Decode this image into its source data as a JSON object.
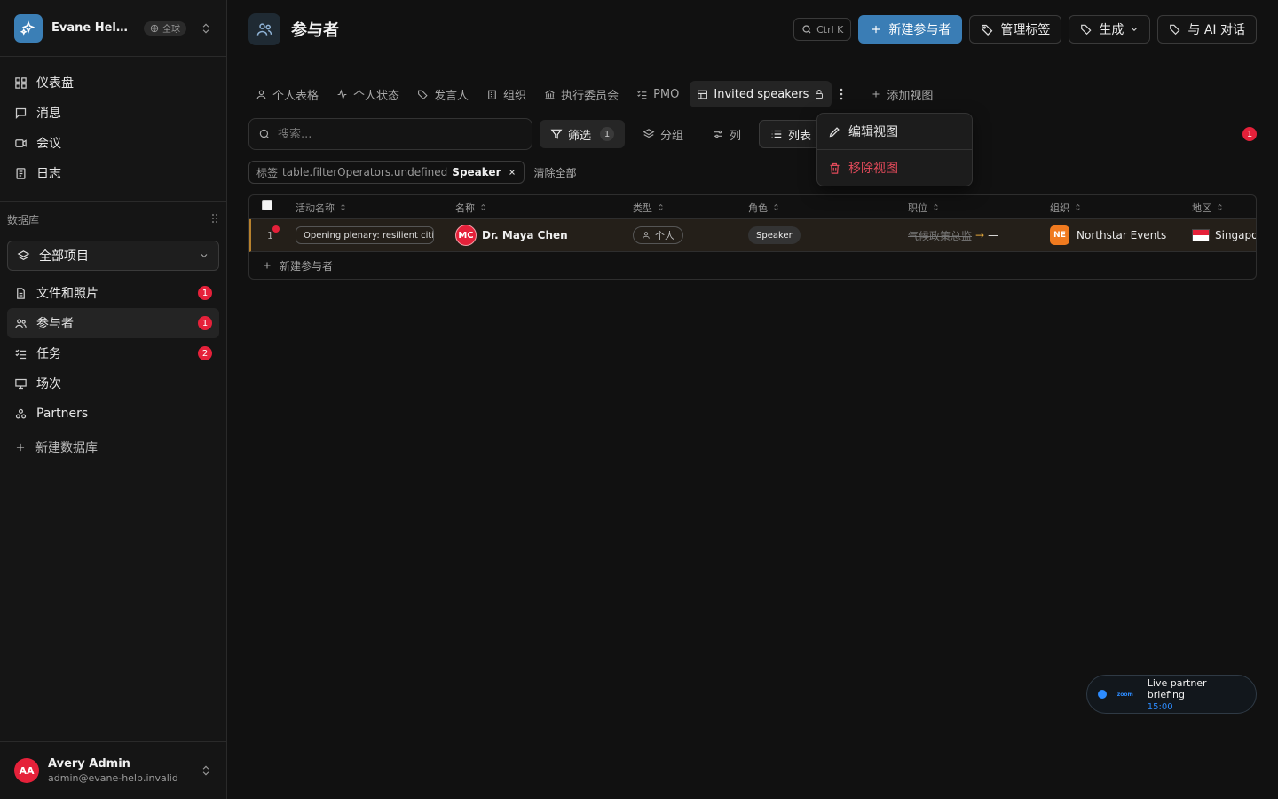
{
  "workspace": {
    "name": "Evane Help Center",
    "scope": "全球"
  },
  "nav": [
    {
      "label": "仪表盘",
      "icon": "dashboard-icon"
    },
    {
      "label": "消息",
      "icon": "message-icon"
    },
    {
      "label": "会议",
      "icon": "video-icon"
    },
    {
      "label": "日志",
      "icon": "log-icon"
    }
  ],
  "database": {
    "section_label": "数据库",
    "selector_label": "全部项目",
    "items": [
      {
        "label": "文件和照片",
        "badge": "1",
        "icon": "file-icon"
      },
      {
        "label": "参与者",
        "badge": "1",
        "icon": "users-icon",
        "active": true
      },
      {
        "label": "任务",
        "badge": "2",
        "icon": "tasks-icon"
      },
      {
        "label": "场次",
        "badge": "",
        "icon": "presentation-icon"
      },
      {
        "label": "Partners",
        "badge": "",
        "icon": "partners-icon"
      }
    ],
    "new_label": "新建数据库"
  },
  "user": {
    "initials": "AA",
    "name": "Avery Admin",
    "email": "admin@evane-help.invalid"
  },
  "header": {
    "title": "参与者",
    "shortcut": "Ctrl K",
    "new_button": "新建参与者",
    "manage_tags": "管理标签",
    "generate": "生成",
    "ai_chat": "与 AI 对话"
  },
  "tabs": [
    {
      "label": "个人表格",
      "icon": "person-icon"
    },
    {
      "label": "个人状态",
      "icon": "activity-icon"
    },
    {
      "label": "发言人",
      "icon": "tag-icon"
    },
    {
      "label": "组织",
      "icon": "building-icon"
    },
    {
      "label": "执行委员会",
      "icon": "bank-icon"
    },
    {
      "label": "PMO",
      "icon": "checklist-icon"
    },
    {
      "label": "Invited speakers",
      "icon": "table-icon",
      "active": true
    },
    {
      "label": "添加视图",
      "icon": "plus-icon"
    }
  ],
  "toolbar": {
    "search_placeholder": "搜索...",
    "filter_label": "筛选",
    "filter_count": "1",
    "group_label": "分组",
    "columns_label": "列",
    "list_label": "列表",
    "notification_count": "1"
  },
  "filter_chip": {
    "field": "标签",
    "operator": "table.filterOperators.undefined",
    "value": "Speaker"
  },
  "clear_all": "清除全部",
  "table": {
    "columns": [
      "活动名称",
      "名称",
      "类型",
      "角色",
      "职位",
      "组织",
      "地区"
    ],
    "rows": [
      {
        "num": "1",
        "event": "Opening plenary: resilient cities",
        "initials": "MC",
        "name": "Dr. Maya Chen",
        "type": "个人",
        "role": "Speaker",
        "position_old": "气候政策总监",
        "position_arrow": "→",
        "position_new": "—",
        "org_initials": "NE",
        "org": "Northstar Events",
        "region": "Singapore"
      }
    ],
    "add_row_label": "新建参与者"
  },
  "view_menu": {
    "edit": "编辑视图",
    "remove": "移除视图"
  },
  "meeting": {
    "logo": "zoom",
    "title": "Live partner briefing",
    "time": "15:00"
  }
}
